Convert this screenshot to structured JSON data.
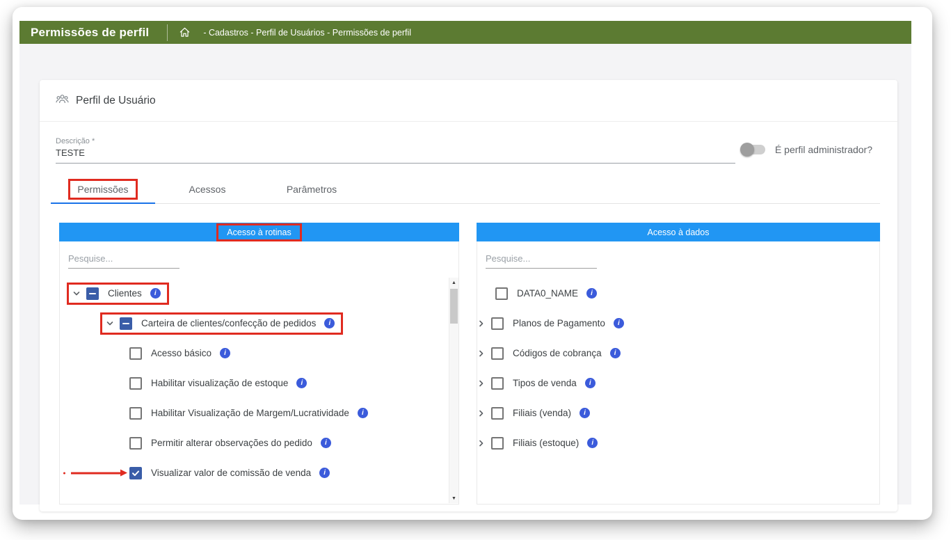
{
  "colors": {
    "topbar_green": "#5c7b32",
    "panel_header_blue": "#2196f3",
    "checkbox_blue": "#3a5da8",
    "info_icon_blue": "#3b5bdb",
    "tab_active_blue": "#1a73e8",
    "annotation_red": "#e02b20"
  },
  "header": {
    "title": "Permissões de perfil",
    "breadcrumb": "- Cadastros - Perfil de Usuários - Permissões de perfil"
  },
  "card": {
    "title": "Perfil de Usuário"
  },
  "form": {
    "description_label": "Descrição *",
    "description_value": "TESTE",
    "admin_toggle_label": "É perfil administrador?",
    "admin_toggle_state": "off"
  },
  "tabs": [
    {
      "label": "Permissões",
      "active": true,
      "annotated": true
    },
    {
      "label": "Acessos",
      "active": false,
      "annotated": false
    },
    {
      "label": "Parâmetros",
      "active": false,
      "annotated": false
    }
  ],
  "routines_panel": {
    "title": "Acesso à rotinas",
    "title_annotated": true,
    "search_placeholder": "Pesquise...",
    "tree": [
      {
        "label": "Clientes",
        "level": 0,
        "chevron": "down",
        "checkbox": "indeterminate",
        "info": true,
        "annotated": true
      },
      {
        "label": "Carteira de clientes/confecção de pedidos",
        "level": 1,
        "chevron": "down",
        "checkbox": "indeterminate",
        "info": true,
        "annotated": true
      },
      {
        "label": "Acesso básico",
        "level": 2,
        "chevron": null,
        "checkbox": "unchecked",
        "info": true,
        "annotated": false
      },
      {
        "label": "Habilitar visualização de estoque",
        "level": 2,
        "chevron": null,
        "checkbox": "unchecked",
        "info": true,
        "annotated": false
      },
      {
        "label": "Habilitar Visualização de Margem/Lucratividade",
        "level": 2,
        "chevron": null,
        "checkbox": "unchecked",
        "info": true,
        "annotated": false
      },
      {
        "label": "Permitir alterar observações do pedido",
        "level": 2,
        "chevron": null,
        "checkbox": "unchecked",
        "info": true,
        "annotated": false
      },
      {
        "label": "Visualizar valor de comissão de venda",
        "level": 2,
        "chevron": null,
        "checkbox": "checked",
        "info": true,
        "annotated": false,
        "pointer_arrow": true
      }
    ]
  },
  "data_panel": {
    "title": "Acesso à dados",
    "search_placeholder": "Pesquise...",
    "items": [
      {
        "label": "DATA0_NAME",
        "chevron": null,
        "checkbox": "unchecked",
        "info": true
      },
      {
        "label": "Planos de Pagamento",
        "chevron": "right",
        "checkbox": "unchecked",
        "info": true
      },
      {
        "label": "Códigos de cobrança",
        "chevron": "right",
        "checkbox": "unchecked",
        "info": true
      },
      {
        "label": "Tipos de venda",
        "chevron": "right",
        "checkbox": "unchecked",
        "info": true
      },
      {
        "label": "Filiais (venda)",
        "chevron": "right",
        "checkbox": "unchecked",
        "info": true
      },
      {
        "label": "Filiais (estoque)",
        "chevron": "right",
        "checkbox": "unchecked",
        "info": true
      }
    ]
  }
}
